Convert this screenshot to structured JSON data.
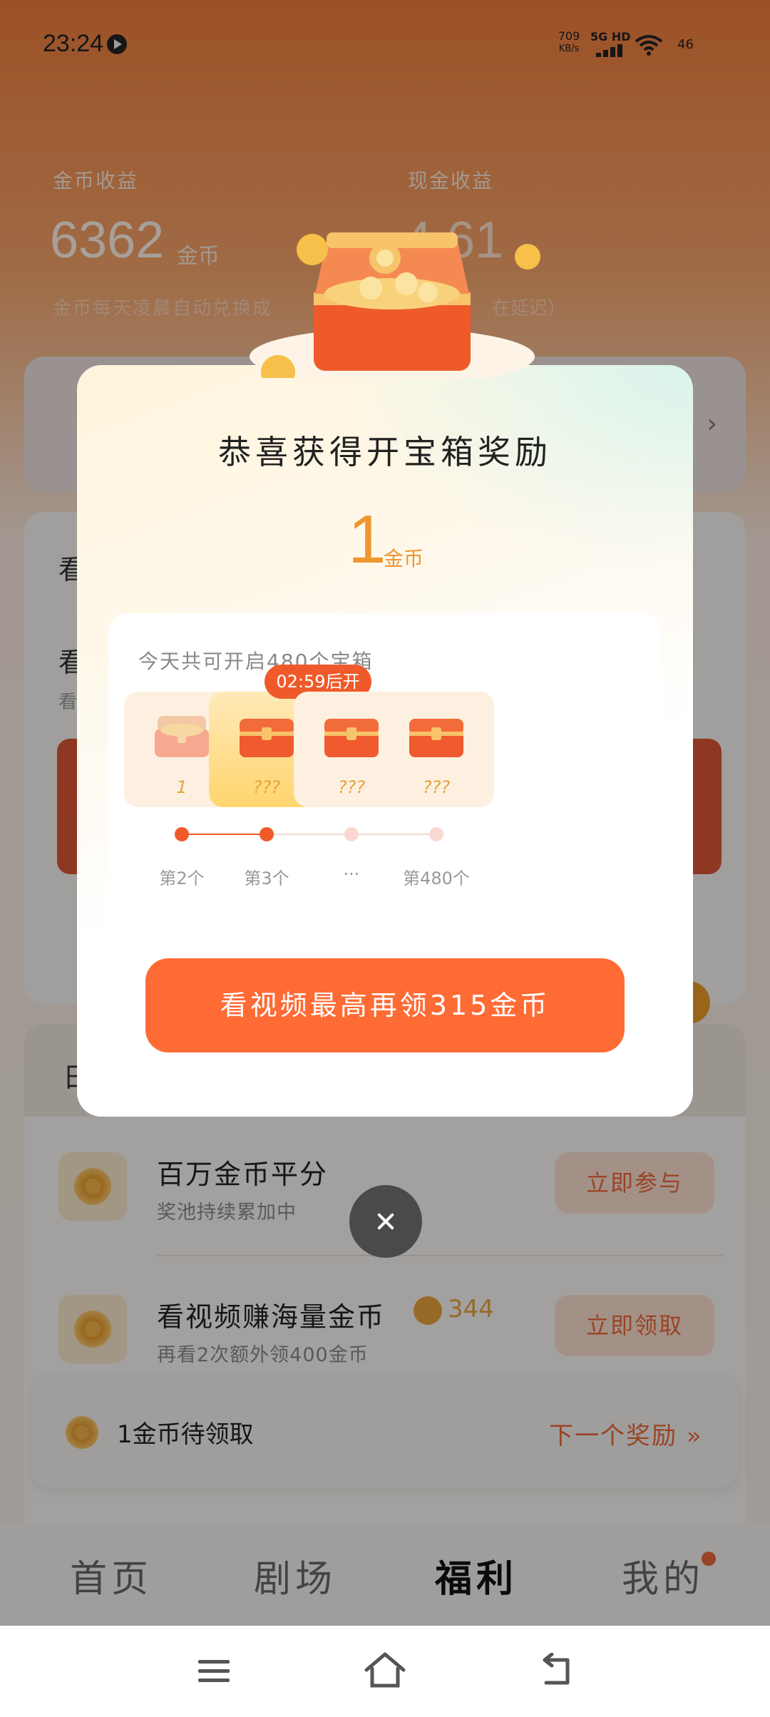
{
  "status_bar": {
    "time": "23:24",
    "net_speed": "709",
    "net_speed_unit": "KB/s",
    "network": "5G HD",
    "battery": "46"
  },
  "earnings": {
    "coin_label": "金币收益",
    "coin_value": "6362",
    "coin_unit": "金币",
    "cash_label": "现金收益",
    "cash_value": "4.61",
    "note_left": "金币每天凌晨自动兑换成",
    "note_right": "在延迟）"
  },
  "watch_section": {
    "title": "看",
    "task_title": "看",
    "task_sub": "看"
  },
  "daily_section": {
    "title": "日"
  },
  "tasks": [
    {
      "title": "百万金币平分",
      "sub": "奖池持续累加中",
      "button": "立即参与",
      "badge": ""
    },
    {
      "title": "看视频赚海量金币",
      "sub": "再看2次额外领400金币",
      "button": "立即领取",
      "badge": "344"
    }
  ],
  "pending": {
    "text": "1金币待领取",
    "next": "下一个奖励"
  },
  "tabs": [
    {
      "label": "首页",
      "active": false
    },
    {
      "label": "剧场",
      "active": false
    },
    {
      "label": "福利",
      "active": true
    },
    {
      "label": "我的",
      "active": false
    }
  ],
  "dialog": {
    "title": "恭喜获得开宝箱奖励",
    "amount": "1",
    "unit": "金币",
    "subtitle": "今天共可开启480个宝箱",
    "timer": "02:59后开",
    "boxes": [
      {
        "label": "1",
        "opened": true
      },
      {
        "label": "???",
        "opened": false
      },
      {
        "label": "???",
        "opened": false
      },
      {
        "label": "???",
        "opened": false
      }
    ],
    "track_labels": [
      "第2个",
      "第3个",
      "···",
      "第480个"
    ],
    "cta": "看视频最高再领315金币"
  },
  "colors": {
    "accent": "#ff6b35",
    "coin": "#f0962e",
    "timer": "#f05a2a"
  }
}
